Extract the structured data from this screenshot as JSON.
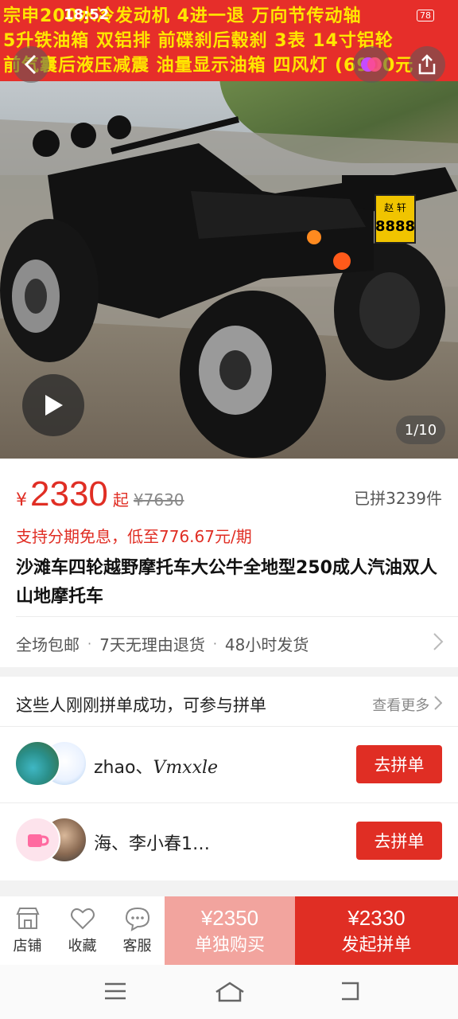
{
  "hero": {
    "banner_lines": [
      "宗申200水冷发动机  4进一退  万向节传动轴",
      "5升铁油箱  双铝排  前碟刹后毂刹  3表  14寸铝轮",
      "前气囊后液压减震  油量显示油箱  四风灯  (6900元"
    ],
    "status_time": "18:52",
    "battery": "78",
    "plate_top": "赵 轩",
    "plate_num": "8888",
    "image_counter": "1/10"
  },
  "price": {
    "currency": "¥",
    "value": "2330",
    "suffix": "起",
    "original": "¥7630",
    "sold": "已拼3239件",
    "installment": "支持分期免息，低至776.67元/期",
    "title": "沙滩车四轮越野摩托车大公牛全地型250成人汽油双人山地摩托车",
    "services": [
      "全场包邮",
      "7天无理由退货",
      "48小时发货"
    ],
    "separator": "·"
  },
  "group": {
    "heading": "这些人刚刚拼单成功，可参与拼单",
    "see_more": "查看更多",
    "rows": [
      {
        "names": "zhao、",
        "signature": "Vmxxle",
        "button": "去拼单"
      },
      {
        "names": "海、李小春1…",
        "button": "去拼单"
      }
    ]
  },
  "bottom_bar": {
    "tabs": [
      "店铺",
      "收藏",
      "客服"
    ],
    "solo_price": "¥2350",
    "solo_label": "单独购买",
    "group_price": "¥2330",
    "group_label": "发起拼单"
  },
  "colors": {
    "accent": "#e02e24",
    "banner": "#e62e2a",
    "banner_text": "#ffe600",
    "solo_button": "#f2a49e"
  }
}
